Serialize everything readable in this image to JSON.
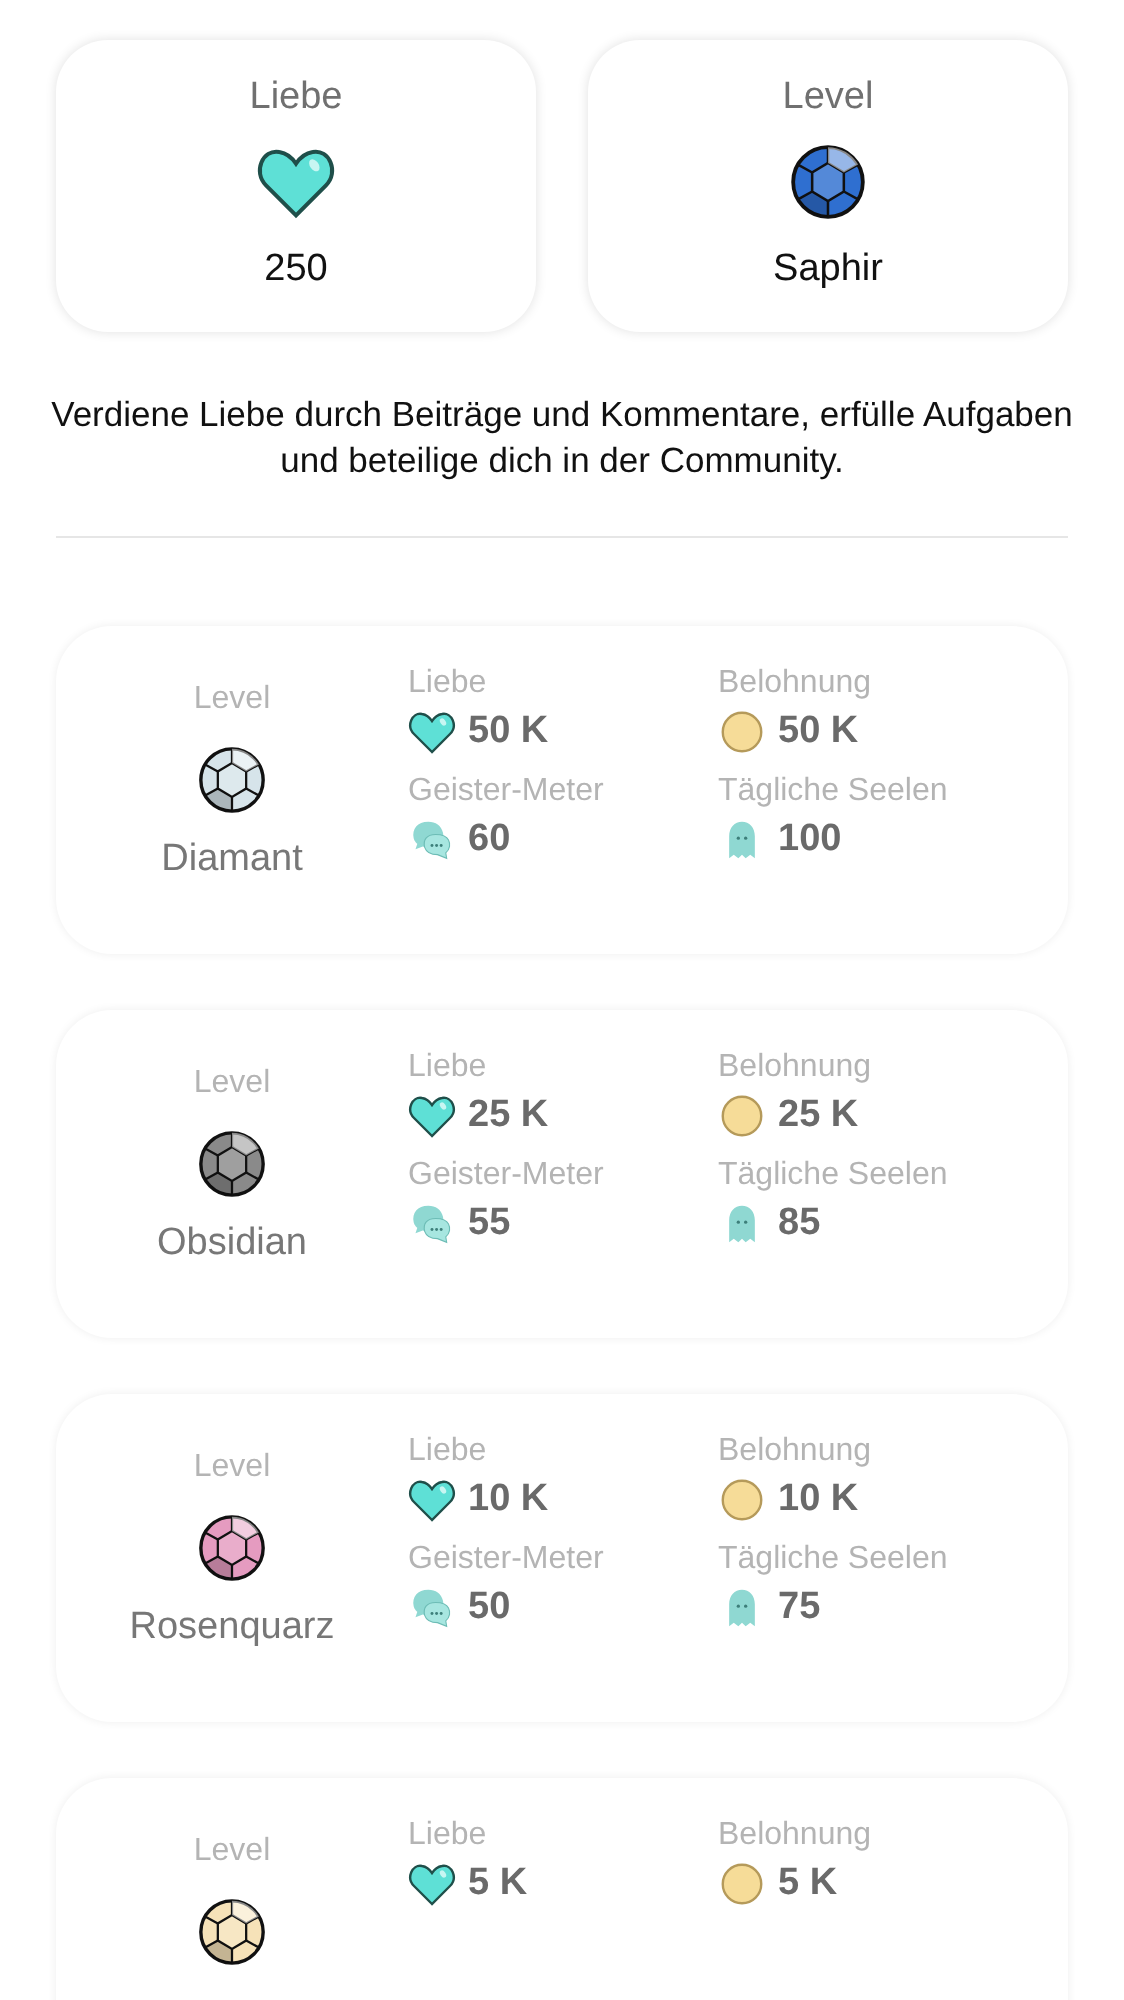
{
  "summary": [
    {
      "kind": "love",
      "label": "Liebe",
      "value": "250"
    },
    {
      "kind": "level",
      "label": "Level",
      "value": "Saphir",
      "color": "#2f6fd0"
    }
  ],
  "info": "Verdiene Liebe durch Beiträge und Kommentare, erfülle Aufgaben und beteilige dich in der Community.",
  "levels": [
    {
      "label": "Level",
      "name": "Diamant",
      "color": "#d6e4ea",
      "stats": [
        {
          "kind": "love",
          "label": "Liebe",
          "value": "50 K"
        },
        {
          "kind": "coin",
          "label": "Belohnung",
          "value": "50 K"
        },
        {
          "kind": "meter",
          "label": "Geister-Meter",
          "value": "60"
        },
        {
          "kind": "ghost",
          "label": "Tägliche Seelen",
          "value": "100"
        }
      ]
    },
    {
      "label": "Level",
      "name": "Obsidian",
      "color": "#8a8a8a",
      "stats": [
        {
          "kind": "love",
          "label": "Liebe",
          "value": "25 K"
        },
        {
          "kind": "coin",
          "label": "Belohnung",
          "value": "25 K"
        },
        {
          "kind": "meter",
          "label": "Geister-Meter",
          "value": "55"
        },
        {
          "kind": "ghost",
          "label": "Tägliche Seelen",
          "value": "85"
        }
      ]
    },
    {
      "label": "Level",
      "name": "Rosenquarz",
      "color": "#e59bc0",
      "stats": [
        {
          "kind": "love",
          "label": "Liebe",
          "value": "10 K"
        },
        {
          "kind": "coin",
          "label": "Belohnung",
          "value": "10 K"
        },
        {
          "kind": "meter",
          "label": "Geister-Meter",
          "value": "50"
        },
        {
          "kind": "ghost",
          "label": "Tägliche Seelen",
          "value": "75"
        }
      ]
    },
    {
      "label": "Level",
      "color": "#f6e2b8",
      "stats": [
        {
          "kind": "love",
          "label": "Liebe",
          "value": "5 K"
        },
        {
          "kind": "coin",
          "label": "Belohnung",
          "value": "5 K"
        }
      ]
    }
  ]
}
